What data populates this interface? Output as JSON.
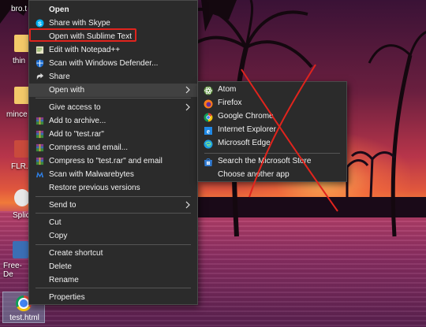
{
  "desktop": {
    "icons": [
      {
        "label": "bro.t"
      },
      {
        "label": "thin"
      },
      {
        "label": "mince"
      },
      {
        "label": "FLR.z"
      },
      {
        "label": "Splic"
      },
      {
        "label": "Free-De"
      }
    ],
    "taskbar_file": {
      "label": "test.html",
      "icon": "chrome-icon"
    }
  },
  "context_menu": {
    "items": [
      {
        "label": "Open",
        "bold": true
      },
      {
        "label": "Share with Skype",
        "icon": "skype-icon"
      },
      {
        "label": "Open with Sublime Text",
        "highlighted": true
      },
      {
        "label": "Edit with Notepad++",
        "icon": "notepad-plus-plus-icon"
      },
      {
        "label": "Scan with Windows Defender...",
        "icon": "windows-defender-icon"
      },
      {
        "label": "Share",
        "icon": "share-icon"
      },
      {
        "label": "Open with",
        "submenu": true,
        "hover": true
      },
      {
        "label": "Give access to",
        "submenu": true
      },
      {
        "label": "Add to archive...",
        "icon": "winrar-icon"
      },
      {
        "label": "Add to \"test.rar\"",
        "icon": "winrar-icon"
      },
      {
        "label": "Compress and email...",
        "icon": "winrar-icon"
      },
      {
        "label": "Compress to \"test.rar\" and email",
        "icon": "winrar-icon"
      },
      {
        "label": "Scan with Malwarebytes",
        "icon": "malwarebytes-icon"
      },
      {
        "label": "Restore previous versions"
      },
      {
        "label": "Send to",
        "submenu": true
      },
      {
        "label": "Cut"
      },
      {
        "label": "Copy"
      },
      {
        "label": "Create shortcut"
      },
      {
        "label": "Delete"
      },
      {
        "label": "Rename"
      },
      {
        "label": "Properties"
      }
    ]
  },
  "open_with_submenu": {
    "items": [
      {
        "label": "Atom",
        "icon": "atom-icon"
      },
      {
        "label": "Firefox",
        "icon": "firefox-icon"
      },
      {
        "label": "Google Chrome",
        "icon": "chrome-icon"
      },
      {
        "label": "Internet Explorer",
        "icon": "internet-explorer-icon"
      },
      {
        "label": "Microsoft Edge",
        "icon": "edge-icon"
      },
      {
        "label": "Search the Microsoft Store",
        "icon": "store-icon"
      },
      {
        "label": "Choose another app"
      }
    ]
  },
  "annotation": {
    "highlight_color": "#e0241d",
    "cross_color": "#e0241d"
  }
}
